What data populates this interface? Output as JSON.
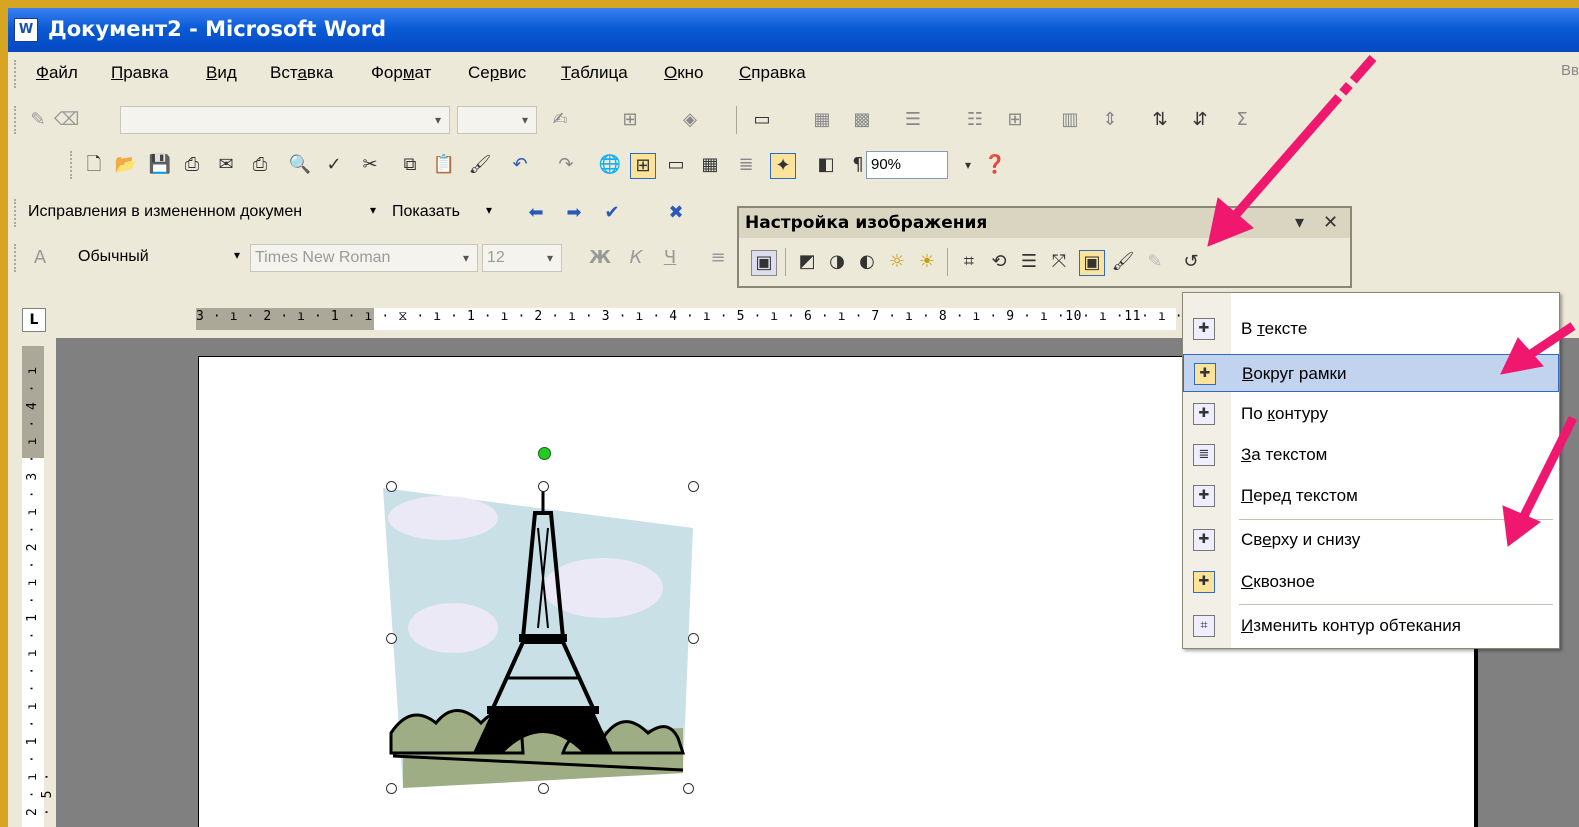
{
  "window": {
    "title": "Документ2 - Microsoft Word",
    "app_icon": "W"
  },
  "menubar": {
    "items": [
      {
        "pre": "",
        "ul": "Ф",
        "post": "айл"
      },
      {
        "pre": "",
        "ul": "П",
        "post": "равка"
      },
      {
        "pre": "",
        "ul": "В",
        "post": "ид"
      },
      {
        "pre": "Вст",
        "ul": "а",
        "post": "вка"
      },
      {
        "pre": "Фор",
        "ul": "м",
        "post": "ат"
      },
      {
        "pre": "Се",
        "ul": "р",
        "post": "вис"
      },
      {
        "pre": "",
        "ul": "Т",
        "post": "аблица"
      },
      {
        "pre": "",
        "ul": "О",
        "post": "кно"
      },
      {
        "pre": "",
        "ul": "С",
        "post": "правка"
      }
    ],
    "ask_box": "Вв"
  },
  "standard_toolbar": {
    "zoom": "90%"
  },
  "reviewing_toolbar": {
    "display_mode": "Исправления в измененном докумен",
    "show_label": "Показать"
  },
  "formatting_toolbar": {
    "style": "Обычный",
    "font": "Times New Roman",
    "size": "12"
  },
  "ruler": {
    "numbers": "3 · ı · 2 · ı · 1 · ı · ⧖ · ı · 1 · ı · 2 · ı · 3 · ı · 4 · ı · 5 · ı · 6 · ı · 7 · ı · 8 · ı · 9 · ı ·10· ı ·11· ı ·12· ı ·13",
    "vertical": "2 · ı · 1 · ı · · ı · 1 · ı · 2 · ı · 3 · ı · 4 · ı · 5 ·",
    "tab_selector": "L"
  },
  "picture_toolbar": {
    "title": "Настройка изображения"
  },
  "wrap_menu": {
    "items": [
      {
        "pre": "В ",
        "ul": "т",
        "post": "ексте"
      },
      {
        "pre": "",
        "ul": "В",
        "post": "округ рамки"
      },
      {
        "pre": "По ",
        "ul": "к",
        "post": "онтуру"
      },
      {
        "pre": "",
        "ul": "З",
        "post": "а текстом"
      },
      {
        "pre": "",
        "ul": "П",
        "post": "еред текстом"
      },
      {
        "pre": "Св",
        "ul": "е",
        "post": "рху и снизу"
      },
      {
        "pre": "",
        "ul": "С",
        "post": "квозное"
      },
      {
        "pre": "",
        "ul": "И",
        "post": "зменить контур обтекания"
      }
    ],
    "highlighted_index": 1
  },
  "colors": {
    "frame": "#d7a521",
    "titlebar": "#0a5bd6",
    "arrow": "#f0186e",
    "highlight": "#c2d3ef"
  }
}
